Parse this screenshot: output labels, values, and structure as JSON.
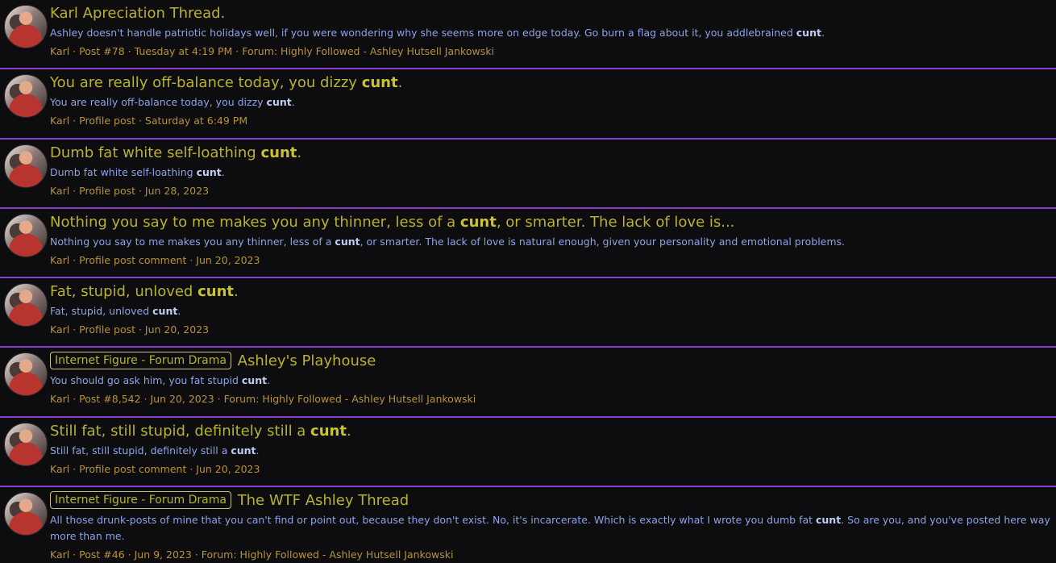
{
  "results": [
    {
      "title_parts": [
        "Karl Apreciation Thread.",
        "",
        ""
      ],
      "prefix": "",
      "snippet_parts": [
        "Ashley doesn't handle patriotic holidays well, if you were wondering why she seems more on edge today. Go burn a flag about it, you addlebrained ",
        "cunt",
        "."
      ],
      "meta": "Karl · Post #78 · Tuesday at 4:19 PM · Forum: Highly Followed - Ashley Hutsell Jankowski"
    },
    {
      "title_parts": [
        "You are really off-balance today, you dizzy ",
        "cunt",
        "."
      ],
      "prefix": "",
      "snippet_parts": [
        "You are really off-balance today, you dizzy ",
        "cunt",
        "."
      ],
      "meta": "Karl · Profile post · Saturday at 6:49 PM"
    },
    {
      "title_parts": [
        "Dumb fat white self-loathing ",
        "cunt",
        "."
      ],
      "prefix": "",
      "snippet_parts": [
        "Dumb fat white self-loathing ",
        "cunt",
        "."
      ],
      "meta": "Karl · Profile post · Jun 28, 2023"
    },
    {
      "title_parts": [
        "Nothing you say to me makes you any thinner, less of a ",
        "cunt",
        ", or smarter. The lack of love is..."
      ],
      "prefix": "",
      "snippet_parts": [
        "Nothing you say to me makes you any thinner, less of a ",
        "cunt",
        ", or smarter. The lack of love is natural enough, given your personality and emotional problems."
      ],
      "meta": "Karl · Profile post comment · Jun 20, 2023"
    },
    {
      "title_parts": [
        "Fat, stupid, unloved ",
        "cunt",
        "."
      ],
      "prefix": "",
      "snippet_parts": [
        "Fat, stupid, unloved ",
        "cunt",
        "."
      ],
      "meta": "Karl · Profile post · Jun 20, 2023"
    },
    {
      "title_parts": [
        "Ashley's Playhouse",
        "",
        ""
      ],
      "prefix": "Internet Figure - Forum Drama",
      "snippet_parts": [
        "You should go ask him, you fat stupid ",
        "cunt",
        "."
      ],
      "meta": "Karl · Post #8,542 · Jun 20, 2023 · Forum: Highly Followed - Ashley Hutsell Jankowski"
    },
    {
      "title_parts": [
        "Still fat, still stupid, definitely still a ",
        "cunt",
        "."
      ],
      "prefix": "",
      "snippet_parts": [
        "Still fat, still stupid, definitely still a ",
        "cunt",
        "."
      ],
      "meta": "Karl · Profile post comment · Jun 20, 2023"
    },
    {
      "title_parts": [
        "The WTF Ashley Thread",
        "",
        ""
      ],
      "prefix": "Internet Figure - Forum Drama",
      "snippet_parts": [
        "All those drunk-posts of mine that you can't find or point out, because they don't exist. No, it's incarcerate. Which is exactly what I wrote you dumb fat ",
        "cunt",
        ". So are you, and you've posted here way more than me."
      ],
      "meta": "Karl · Post #46 · Jun 9, 2023 · Forum: Highly Followed - Ashley Hutsell Jankowski"
    }
  ]
}
